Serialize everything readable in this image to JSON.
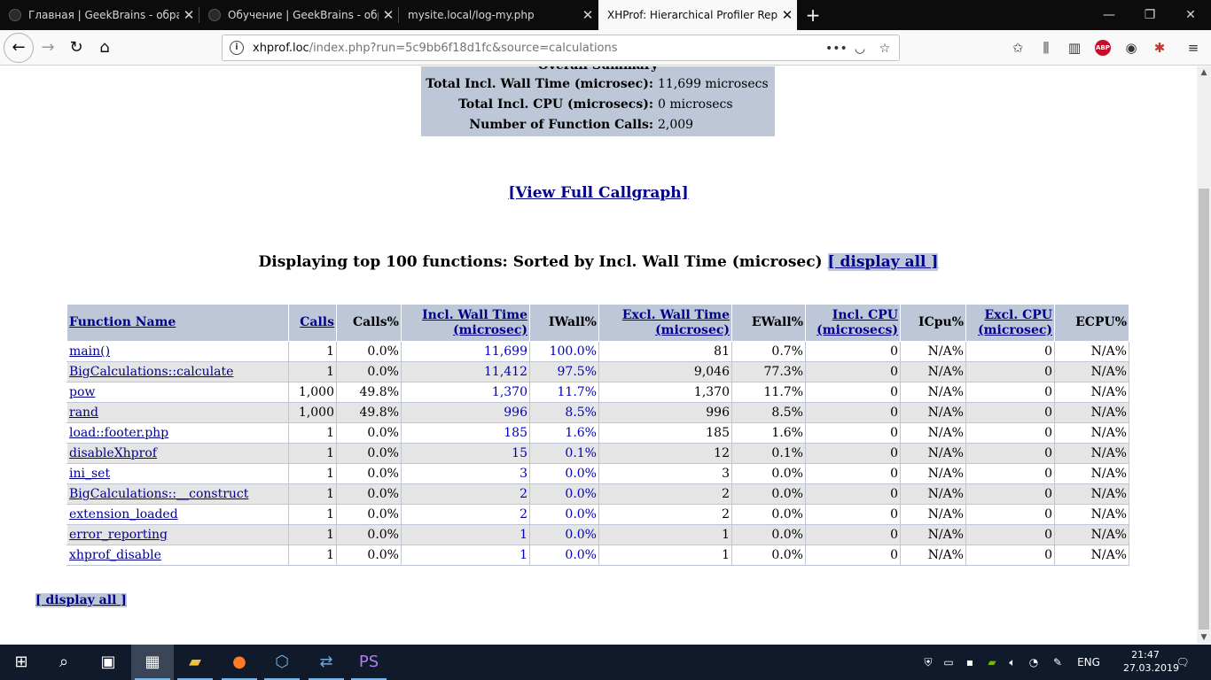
{
  "browser": {
    "tabs": [
      {
        "title": "Главная | GeekBrains - образо",
        "active": false
      },
      {
        "title": "Обучение | GeekBrains - обра",
        "active": false
      },
      {
        "title": "mysite.local/log-my.php",
        "active": false
      },
      {
        "title": "XHProf: Hierarchical Profiler Report",
        "active": true
      }
    ],
    "url_host": "xhprof.loc",
    "url_path": "/index.php?run=5c9bb6f18d1fc&source=calculations"
  },
  "summary": {
    "title": "Overall Summary",
    "rows": [
      {
        "label": "Total Incl. Wall Time (microsec):",
        "value": "11,699 microsecs"
      },
      {
        "label": "Total Incl. CPU (microsecs):",
        "value": "0 microsecs"
      },
      {
        "label": "Number of Function Calls:",
        "value": "2,009"
      }
    ]
  },
  "callgraph_link": "[View Full Callgraph]",
  "heading": {
    "text": "Displaying top 100 functions: Sorted by Incl. Wall Time (microsec)",
    "display_all": "[ display all ]"
  },
  "table": {
    "headers": {
      "function_name": "Function Name",
      "calls": "Calls",
      "calls_pct": "Calls%",
      "incl_wall_1": "Incl. Wall Time",
      "incl_wall_2": "(microsec)",
      "iwall": "IWall%",
      "excl_wall_1": "Excl. Wall Time",
      "excl_wall_2": "(microsec)",
      "ewall": "EWall%",
      "incl_cpu_1": "Incl. CPU",
      "incl_cpu_2": "(microsecs)",
      "icpu": "ICpu%",
      "excl_cpu_1": "Excl. CPU",
      "excl_cpu_2": "(microsec)",
      "ecpu": "ECPU%"
    },
    "rows": [
      [
        "main()",
        "1",
        "0.0%",
        "11,699",
        "100.0%",
        "81",
        "0.7%",
        "0",
        "N/A%",
        "0",
        "N/A%"
      ],
      [
        "BigCalculations::calculate",
        "1",
        "0.0%",
        "11,412",
        "97.5%",
        "9,046",
        "77.3%",
        "0",
        "N/A%",
        "0",
        "N/A%"
      ],
      [
        "pow",
        "1,000",
        "49.8%",
        "1,370",
        "11.7%",
        "1,370",
        "11.7%",
        "0",
        "N/A%",
        "0",
        "N/A%"
      ],
      [
        "rand",
        "1,000",
        "49.8%",
        "996",
        "8.5%",
        "996",
        "8.5%",
        "0",
        "N/A%",
        "0",
        "N/A%"
      ],
      [
        "load::footer.php",
        "1",
        "0.0%",
        "185",
        "1.6%",
        "185",
        "1.6%",
        "0",
        "N/A%",
        "0",
        "N/A%"
      ],
      [
        "disableXhprof",
        "1",
        "0.0%",
        "15",
        "0.1%",
        "12",
        "0.1%",
        "0",
        "N/A%",
        "0",
        "N/A%"
      ],
      [
        "ini_set",
        "1",
        "0.0%",
        "3",
        "0.0%",
        "3",
        "0.0%",
        "0",
        "N/A%",
        "0",
        "N/A%"
      ],
      [
        "BigCalculations::__construct",
        "1",
        "0.0%",
        "2",
        "0.0%",
        "2",
        "0.0%",
        "0",
        "N/A%",
        "0",
        "N/A%"
      ],
      [
        "extension_loaded",
        "1",
        "0.0%",
        "2",
        "0.0%",
        "2",
        "0.0%",
        "0",
        "N/A%",
        "0",
        "N/A%"
      ],
      [
        "error_reporting",
        "1",
        "0.0%",
        "1",
        "0.0%",
        "1",
        "0.0%",
        "0",
        "N/A%",
        "0",
        "N/A%"
      ],
      [
        "xhprof_disable",
        "1",
        "0.0%",
        "1",
        "0.0%",
        "1",
        "0.0%",
        "0",
        "N/A%",
        "0",
        "N/A%"
      ]
    ]
  },
  "footer_display_all": "[ display all ]",
  "taskbar": {
    "language": "ENG",
    "time": "21:47",
    "date": "27.03.2019"
  }
}
